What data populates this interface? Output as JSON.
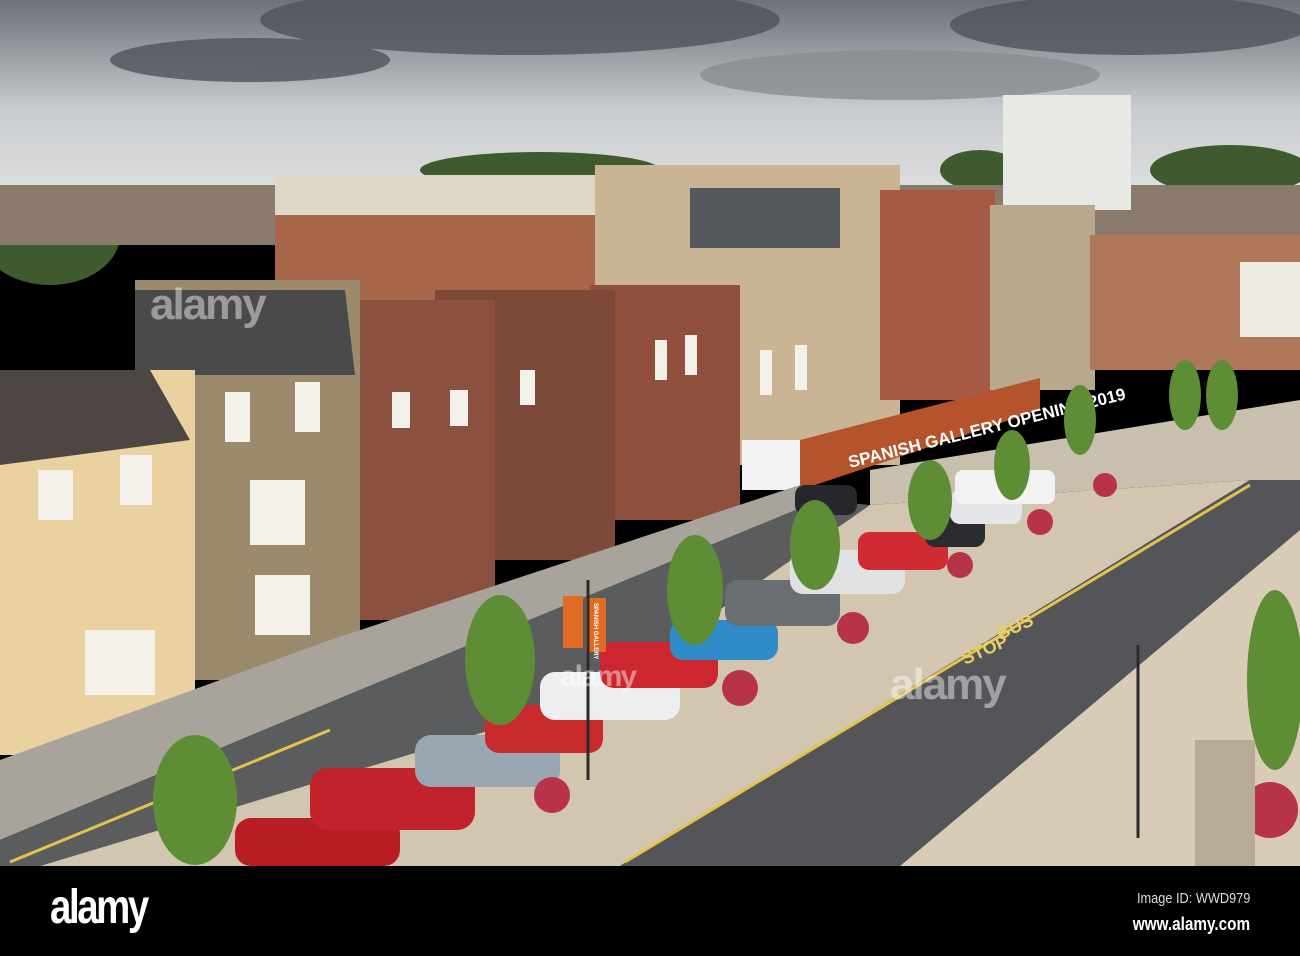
{
  "photo": {
    "hoarding_text": "SPANISH GALLERY OPENING 2019",
    "road_marking_line1": "BUS",
    "road_marking_line2": "STOP",
    "banner_text": "SPANISH GALLERY",
    "watermark": "alamy"
  },
  "footer": {
    "logo": "alamy",
    "image_id": "Image ID: WWD979",
    "url": "www.alamy.com"
  }
}
